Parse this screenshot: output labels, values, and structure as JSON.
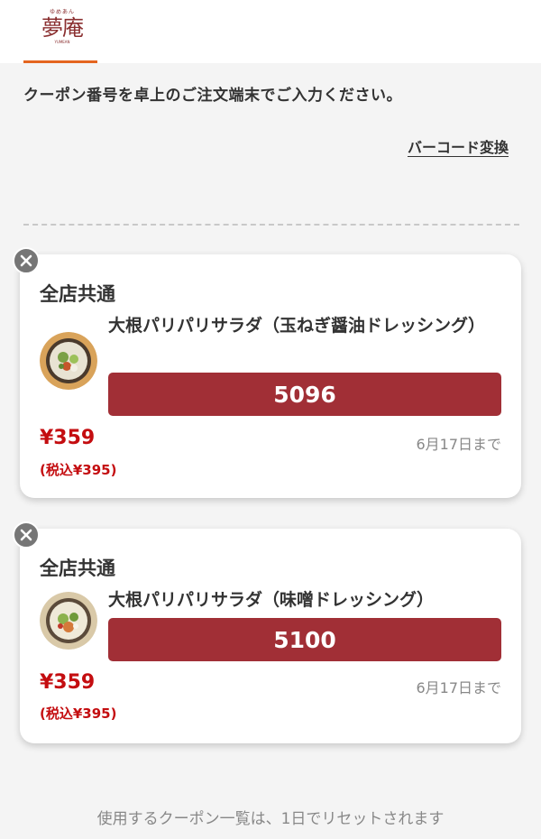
{
  "header": {
    "logo_top": "ゆめあん",
    "logo_main": "夢庵",
    "logo_sub": "YUMEAN"
  },
  "instruction": "クーポン番号を卓上のご注文端末でご入力ください。",
  "barcode_link": "バーコード変換",
  "coupons": [
    {
      "tag": "全店共通",
      "name": "大根パリパリサラダ（玉ねぎ醤油ドレッシング）",
      "code": "5096",
      "price": "¥359",
      "price_tax": "(税込¥395)",
      "expiry": "6月17日まで"
    },
    {
      "tag": "全店共通",
      "name": "大根パリパリサラダ（味噌ドレッシング）",
      "code": "5100",
      "price": "¥359",
      "price_tax": "(税込¥395)",
      "expiry": "6月17日まで"
    }
  ],
  "footer_note": "使用するクーポン一覧は、1日でリセットされます",
  "colors": {
    "brand": "#8a2f30",
    "accent_tab": "#e4651f",
    "code_bg": "#a12f36",
    "price": "#c40d10"
  },
  "icons": {
    "close": "close-icon",
    "thumb": "salad-thumbnail"
  }
}
